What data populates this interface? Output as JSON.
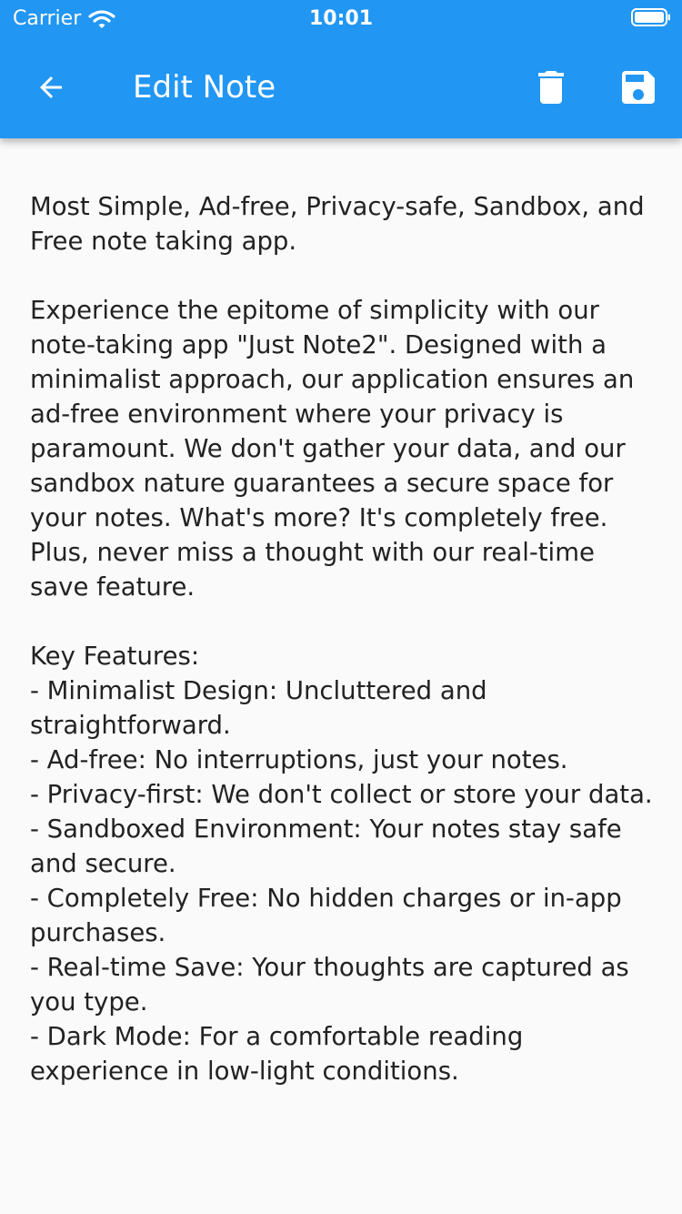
{
  "status_bar": {
    "carrier": "Carrier",
    "time": "10:01",
    "icons": [
      "wifi-icon",
      "battery-icon"
    ]
  },
  "app_bar": {
    "title": "Edit Note",
    "background_color": "#2196f3",
    "icons": {
      "back": "arrow-left-icon",
      "delete": "trash-icon",
      "save": "save-icon"
    }
  },
  "note": {
    "content": "Most Simple, Ad-free, Privacy-safe, Sandbox, and Free note taking app.\n\nExperience the epitome of simplicity with our note-taking app \"Just Note2\". Designed with a minimalist approach, our application ensures an ad-free environment where your privacy is paramount. We don't gather your data, and our sandbox nature guarantees a secure space for your notes. What's more? It's completely free. Plus, never miss a thought with our real-time save feature.\n\nKey Features:\n- Minimalist Design: Uncluttered and straightforward.\n- Ad-free: No interruptions, just your notes.\n- Privacy-first: We don't collect or store your data.\n- Sandboxed Environment: Your notes stay safe and secure.\n- Completely Free: No hidden charges or in-app purchases.\n- Real-time Save: Your thoughts are captured as you type.\n- Dark Mode: For a comfortable reading experience in low-light conditions."
  }
}
